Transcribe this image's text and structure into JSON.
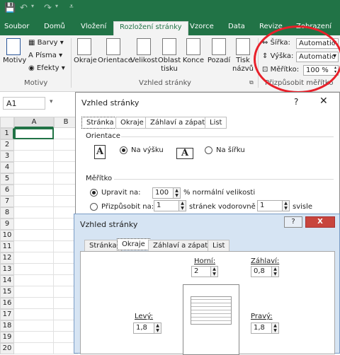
{
  "colors": {
    "accent": "#217346",
    "highlight": "#e8202a"
  },
  "titlebar": {
    "save_icon": "save-icon",
    "undo_icon": "undo-icon",
    "redo_icon": "redo-icon"
  },
  "tabs": [
    "Soubor",
    "Domů",
    "Vložení",
    "Rozložení stránky",
    "Vzorce",
    "Data",
    "Revize",
    "Zobrazení"
  ],
  "ribbon": {
    "groups": {
      "motivy": "Motivy",
      "vzhled": "Vzhled stránky",
      "prizpusobit": "Přizpůsobit měřítko"
    },
    "motivy_btn": "Motivy",
    "barvy": "Barvy",
    "pisma": "Písma",
    "efekty": "Efekty",
    "okraje": "Okraje",
    "orientace": "Orientace",
    "velikost": "Velikost",
    "oblast": "Oblast tisku",
    "konce": "Konce",
    "pozadi": "Pozadí",
    "tisk": "Tisk názvů",
    "sirka_label": "Šířka:",
    "sirka_value": "Automatic",
    "vyska_label": "Výška:",
    "vyska_value": "Automatic",
    "meritko_label": "Měřítko:",
    "meritko_value": "100 %"
  },
  "namebox": "A1",
  "columns": [
    "A",
    "B"
  ],
  "rows": [
    "1",
    "2",
    "3",
    "4",
    "5",
    "6",
    "7",
    "8",
    "9",
    "10",
    "11",
    "12",
    "13",
    "14",
    "15",
    "16",
    "17",
    "18",
    "19",
    "20"
  ],
  "dialog1": {
    "title": "Vzhled stránky",
    "help": "?",
    "close": "✕",
    "tabs": [
      "Stránka",
      "Okraje",
      "Záhlaví a zápatí",
      "List"
    ],
    "orientation_title": "Orientace",
    "portrait": "Na výšku",
    "landscape": "Na šířku",
    "scale_title": "Měřítko",
    "adjust": "Upravit na:",
    "adjust_value": "100",
    "adjust_suffix": "% normální velikosti",
    "fit": "Přizpůsobit na:",
    "fit_wide": "1",
    "fit_mid": "stránek vodorovně a",
    "fit_tall": "1",
    "fit_suffix": "svisle"
  },
  "dialog2": {
    "title": "Vzhled stránky",
    "help": "?",
    "close": "X",
    "tabs": [
      "Stránka",
      "Okraje",
      "Záhlaví a zápatí",
      "List"
    ],
    "top_label": "Horní:",
    "top_value": "2",
    "header_label": "Záhlaví:",
    "header_value": "0,8",
    "left_label": "Levý:",
    "left_value": "1,8",
    "right_label": "Pravý:",
    "right_value": "1,8"
  }
}
